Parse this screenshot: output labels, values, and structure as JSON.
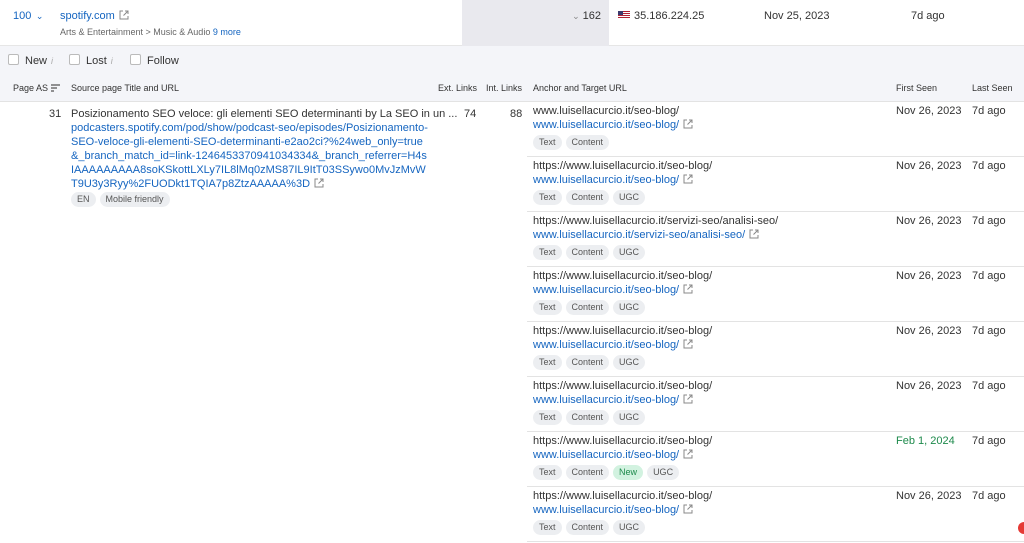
{
  "top_row": {
    "count": "100",
    "domain": "spotify.com",
    "category": "Arts & Entertainment > Music & Audio",
    "more": "9 more",
    "value": "162",
    "ip": "35.186.224.25",
    "date": "Nov 25, 2023",
    "ago": "7d ago"
  },
  "filters": {
    "new": "New",
    "lost": "Lost",
    "follow": "Follow"
  },
  "headers": {
    "page_as": "Page AS",
    "source": "Source page Title and URL",
    "ext_links": "Ext. Links",
    "int_links": "Int. Links",
    "anchor": "Anchor and Target URL",
    "first_seen": "First Seen",
    "last_seen": "Last Seen"
  },
  "row": {
    "page_as": "31",
    "title": "Posizionamento SEO veloce: gli elementi SEO determinanti by La SEO in un ...",
    "url": "podcasters.spotify.com/pod/show/podcast-seo/episodes/Posizionamento-SEO-veloce-gli-elementi-SEO-determinanti-e2ao2ci?%24web_only=true&_branch_match_id=link-1246453370941034334&_branch_referrer=H4sIAAAAAAAAA8soKSkottLXLy7IL8lMq0zMS87IL9ItT03SSywo0MvJzMvWT9U3y3Ryy%2FUODkt1TQIA7p8ZtzAAAAA%3D",
    "tags": [
      "EN",
      "Mobile friendly"
    ],
    "ext_links": "74",
    "int_links": "88"
  },
  "anchors": [
    {
      "text": "www.luisellacurcio.it/seo-blog/",
      "url": "www.luisellacurcio.it/seo-blog/",
      "tags": [
        "Text",
        "Content"
      ],
      "new_tag": false,
      "first_seen": "Nov 26, 2023",
      "first_new": false,
      "last_seen": "7d ago"
    },
    {
      "text": "https://www.luisellacurcio.it/seo-blog/",
      "url": "www.luisellacurcio.it/seo-blog/",
      "tags": [
        "Text",
        "Content",
        "UGC"
      ],
      "new_tag": false,
      "first_seen": "Nov 26, 2023",
      "first_new": false,
      "last_seen": "7d ago"
    },
    {
      "text": "https://www.luisellacurcio.it/servizi-seo/analisi-seo/",
      "url": "www.luisellacurcio.it/servizi-seo/analisi-seo/",
      "tags": [
        "Text",
        "Content",
        "UGC"
      ],
      "new_tag": false,
      "first_seen": "Nov 26, 2023",
      "first_new": false,
      "last_seen": "7d ago"
    },
    {
      "text": "https://www.luisellacurcio.it/seo-blog/",
      "url": "www.luisellacurcio.it/seo-blog/",
      "tags": [
        "Text",
        "Content",
        "UGC"
      ],
      "new_tag": false,
      "first_seen": "Nov 26, 2023",
      "first_new": false,
      "last_seen": "7d ago"
    },
    {
      "text": "https://www.luisellacurcio.it/seo-blog/",
      "url": "www.luisellacurcio.it/seo-blog/",
      "tags": [
        "Text",
        "Content",
        "UGC"
      ],
      "new_tag": false,
      "first_seen": "Nov 26, 2023",
      "first_new": false,
      "last_seen": "7d ago"
    },
    {
      "text": "https://www.luisellacurcio.it/seo-blog/",
      "url": "www.luisellacurcio.it/seo-blog/",
      "tags": [
        "Text",
        "Content",
        "UGC"
      ],
      "new_tag": false,
      "first_seen": "Nov 26, 2023",
      "first_new": false,
      "last_seen": "7d ago"
    },
    {
      "text": "https://www.luisellacurcio.it/seo-blog/",
      "url": "www.luisellacurcio.it/seo-blog/",
      "tags": [
        "Text",
        "Content",
        "New",
        "UGC"
      ],
      "new_tag": true,
      "first_seen": "Feb 1, 2024",
      "first_new": true,
      "last_seen": "7d ago"
    },
    {
      "text": "https://www.luisellacurcio.it/seo-blog/",
      "url": "www.luisellacurcio.it/seo-blog/",
      "tags": [
        "Text",
        "Content",
        "UGC"
      ],
      "new_tag": false,
      "first_seen": "Nov 26, 2023",
      "first_new": false,
      "last_seen": "7d ago"
    }
  ],
  "colors": {
    "link": "#1565c0",
    "new_green": "#1e8a4c",
    "header_bg": "#f4f5f9"
  }
}
